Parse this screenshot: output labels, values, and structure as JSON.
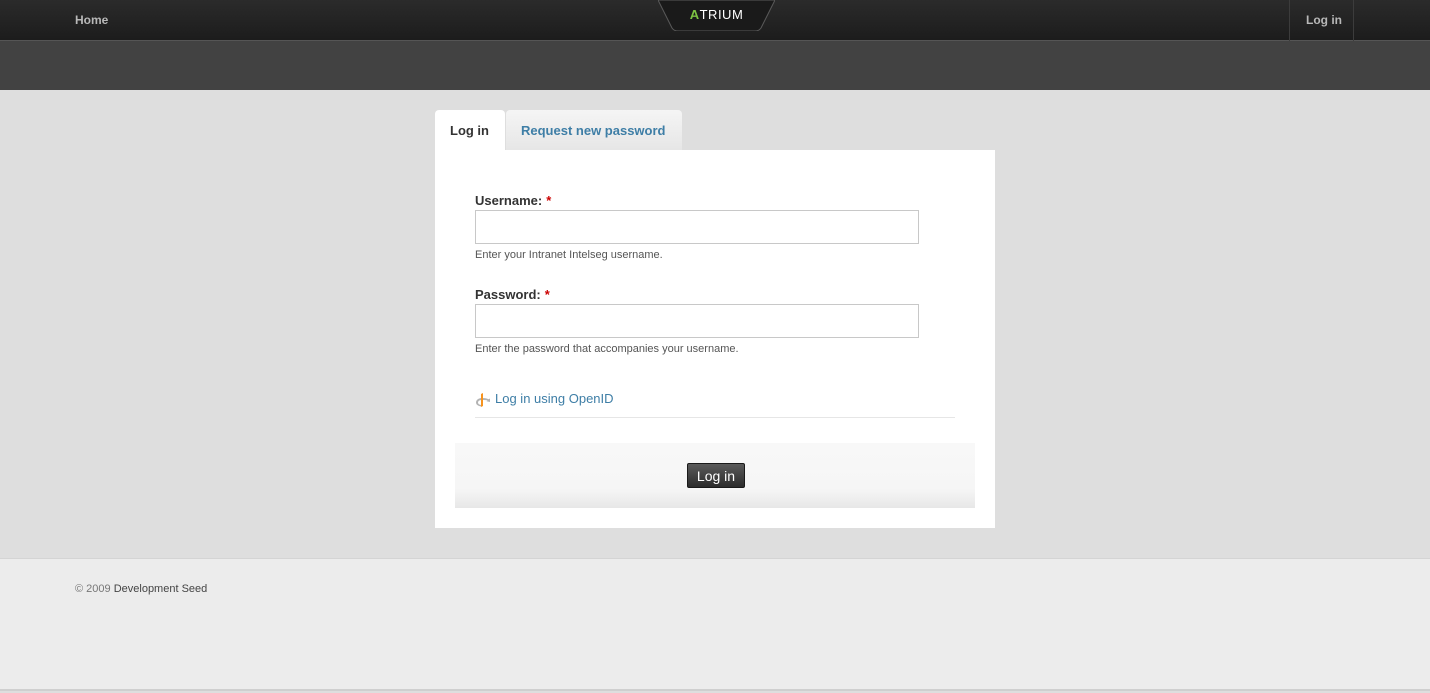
{
  "header": {
    "home_label": "Home",
    "logo_text": "TRIUM",
    "logo_accent": "A",
    "login_label": "Log in"
  },
  "tabs": [
    {
      "label": "Log in",
      "active": true
    },
    {
      "label": "Request new password",
      "active": false
    }
  ],
  "form": {
    "username": {
      "label": "Username:",
      "required_marker": "*",
      "value": "",
      "help": "Enter your Intranet Intelseg username."
    },
    "password": {
      "label": "Password:",
      "required_marker": "*",
      "value": "",
      "help": "Enter the password that accompanies your username."
    },
    "openid_link": "Log in using OpenID",
    "submit_label": "Log in"
  },
  "footer": {
    "copyright": "© 2009",
    "link": "Development Seed"
  },
  "colors": {
    "accent": "#7dc242",
    "link": "#3e7ea6",
    "required": "#cc0000"
  }
}
